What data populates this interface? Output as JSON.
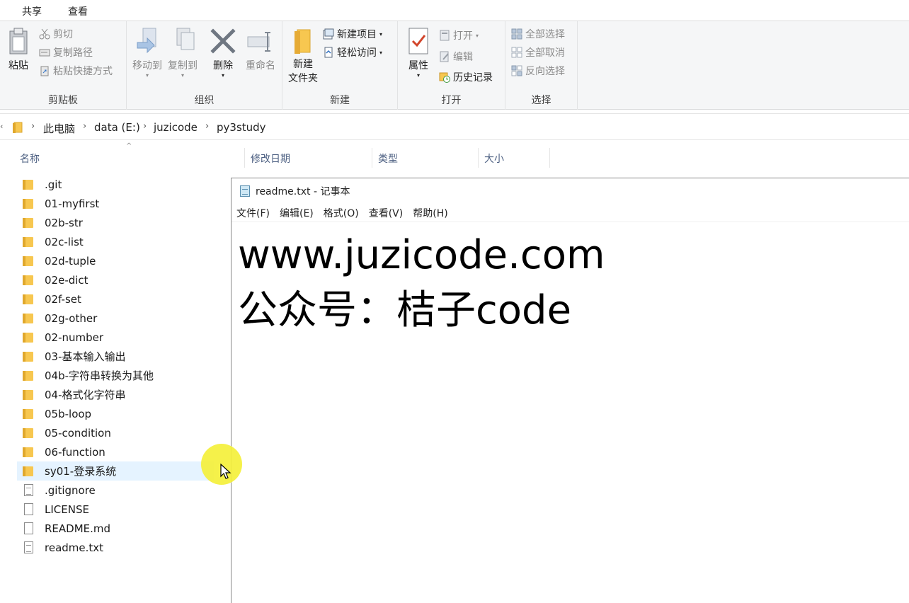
{
  "ribbon_tabs": [
    "共享",
    "查看"
  ],
  "clipboard": {
    "paste": "粘贴",
    "cut": "剪切",
    "copy_path": "复制路径",
    "paste_shortcut": "粘贴快捷方式",
    "label": "剪贴板"
  },
  "organize": {
    "move_to": "移动到",
    "copy_to": "复制到",
    "delete": "删除",
    "rename": "重命名",
    "label": "组织"
  },
  "new": {
    "new_folder_line1": "新建",
    "new_folder_line2": "文件夹",
    "new_item": "新建项目",
    "easy_access": "轻松访问",
    "label": "新建"
  },
  "open": {
    "properties": "属性",
    "open": "打开",
    "edit": "编辑",
    "history": "历史记录",
    "label": "打开"
  },
  "select": {
    "select_all": "全部选择",
    "select_none": "全部取消",
    "invert": "反向选择",
    "label": "选择"
  },
  "breadcrumb": [
    "此电脑",
    "data (E:)",
    "juzicode",
    "py3study"
  ],
  "columns": {
    "name": "名称",
    "date": "修改日期",
    "type": "类型",
    "size": "大小"
  },
  "files": [
    {
      "name": ".git",
      "kind": "folder"
    },
    {
      "name": "01-myfirst",
      "kind": "folder"
    },
    {
      "name": "02b-str",
      "kind": "folder"
    },
    {
      "name": "02c-list",
      "kind": "folder"
    },
    {
      "name": "02d-tuple",
      "kind": "folder"
    },
    {
      "name": "02e-dict",
      "kind": "folder"
    },
    {
      "name": "02f-set",
      "kind": "folder"
    },
    {
      "name": "02g-other",
      "kind": "folder"
    },
    {
      "name": "02-number",
      "kind": "folder"
    },
    {
      "name": "03-基本输入输出",
      "kind": "folder"
    },
    {
      "name": "04b-字符串转换为其他",
      "kind": "folder"
    },
    {
      "name": "04-格式化字符串",
      "kind": "folder"
    },
    {
      "name": "05b-loop",
      "kind": "folder"
    },
    {
      "name": "05-condition",
      "kind": "folder"
    },
    {
      "name": "06-function",
      "kind": "folder"
    },
    {
      "name": "sy01-登录系统",
      "kind": "folder"
    },
    {
      "name": ".gitignore",
      "kind": "text"
    },
    {
      "name": "LICENSE",
      "kind": "file"
    },
    {
      "name": "README.md",
      "kind": "file"
    },
    {
      "name": "readme.txt",
      "kind": "text"
    }
  ],
  "notepad": {
    "title": "readme.txt - 记事本",
    "menu": [
      "文件(F)",
      "编辑(E)",
      "格式(O)",
      "查看(V)",
      "帮助(H)"
    ],
    "lines": [
      "www.juzicode.com",
      "公众号：桔子code"
    ]
  },
  "colors": {
    "selection": "#e5f3ff",
    "folder": "#f7c750",
    "cursor_highlight": "#f4f03b",
    "column_header_text": "#4d6082"
  }
}
